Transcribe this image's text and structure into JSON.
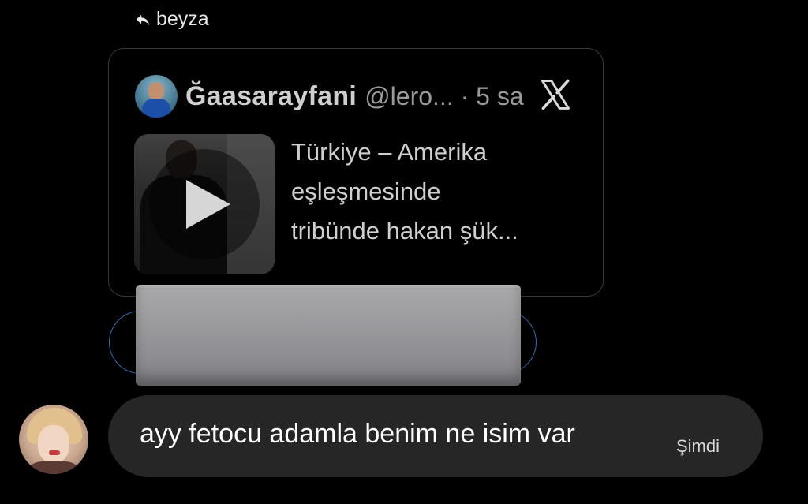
{
  "reply": {
    "icon": "reply-arrow-icon",
    "to_name": "beyza"
  },
  "tweet": {
    "author": "Ğaasarayfani",
    "handle_time": "@lero... · 5 sa",
    "platform_icon": "x-logo-icon",
    "text_lines": [
      "Türkiye – Amerika",
      "eşleşmesinde",
      "tribünde hakan şük..."
    ],
    "media_icon": "play-icon"
  },
  "message": {
    "text": "ayy fetocu adamla benim ne isim var",
    "time": "Şimdi"
  },
  "colors": {
    "background": "#000000",
    "bubble": "#262626",
    "card_border": "#3a3a3a",
    "pill_border": "#2f6db5"
  }
}
